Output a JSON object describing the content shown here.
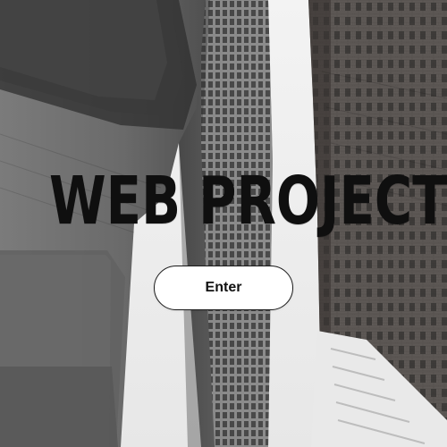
{
  "hero": {
    "title": "WEB PROJECT",
    "button_label": "Enter"
  },
  "background": {
    "type": "upward-view-between-skyscrapers",
    "palette": {
      "sky": "#efefef",
      "concrete_dark": "#3c3c3c",
      "concrete_mid": "#6a6a6a",
      "concrete_light": "#a7a7a7",
      "brick_dark": "#4a4542",
      "brick_mid": "#6f6a66",
      "text": "#0f0f0f",
      "button_fill": "#ffffff",
      "button_border": "#1a1a1a"
    }
  }
}
